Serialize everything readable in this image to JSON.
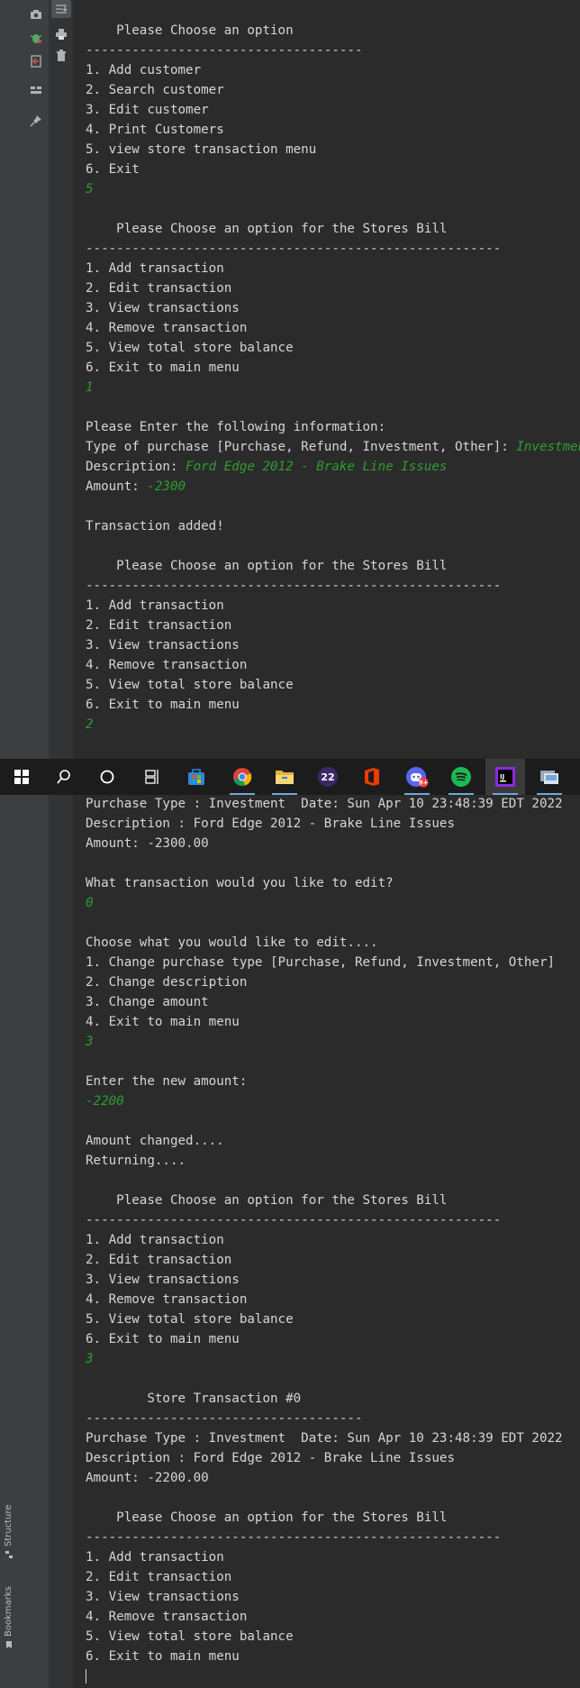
{
  "console_top": [
    {
      "text": "    Please Choose an option"
    },
    {
      "text": "------------------------------------"
    },
    {
      "text": "1. Add customer"
    },
    {
      "text": "2. Search customer"
    },
    {
      "text": "3. Edit customer"
    },
    {
      "text": "4. Print Customers"
    },
    {
      "text": "5. view store transaction menu"
    },
    {
      "text": "6. Exit"
    },
    {
      "input": "5"
    },
    {
      "text": ""
    },
    {
      "text": "    Please Choose an option for the Stores Bill"
    },
    {
      "text": "------------------------------------------------------"
    },
    {
      "text": "1. Add transaction"
    },
    {
      "text": "2. Edit transaction"
    },
    {
      "text": "3. View transactions"
    },
    {
      "text": "4. Remove transaction"
    },
    {
      "text": "5. View total store balance"
    },
    {
      "text": "6. Exit to main menu"
    },
    {
      "input": "1"
    },
    {
      "text": ""
    },
    {
      "text": "Please Enter the following information:"
    },
    {
      "text": "Type of purchase [Purchase, Refund, Investment, Other]: ",
      "input": "Investment"
    },
    {
      "text": "Description: ",
      "input": "Ford Edge 2012 - Brake Line Issues"
    },
    {
      "text": "Amount: ",
      "input": "-2300"
    },
    {
      "text": ""
    },
    {
      "text": "Transaction added!"
    },
    {
      "text": ""
    },
    {
      "text": "    Please Choose an option for the Stores Bill"
    },
    {
      "text": "------------------------------------------------------"
    },
    {
      "text": "1. Add transaction"
    },
    {
      "text": "2. Edit transaction"
    },
    {
      "text": "3. View transactions"
    },
    {
      "text": "4. Remove transaction"
    },
    {
      "text": "5. View total store balance"
    },
    {
      "text": "6. Exit to main menu"
    },
    {
      "input": "2"
    }
  ],
  "console_bottom": [
    {
      "text": "Purchase Type : Investment  Date: Sun Apr 10 23:48:39 EDT 2022"
    },
    {
      "text": "Description : Ford Edge 2012 - Brake Line Issues"
    },
    {
      "text": "Amount: -2300.00"
    },
    {
      "text": ""
    },
    {
      "text": "What transaction would you like to edit?"
    },
    {
      "input": "0"
    },
    {
      "text": ""
    },
    {
      "text": "Choose what you would like to edit...."
    },
    {
      "text": "1. Change purchase type [Purchase, Refund, Investment, Other]"
    },
    {
      "text": "2. Change description"
    },
    {
      "text": "3. Change amount"
    },
    {
      "text": "4. Exit to main menu"
    },
    {
      "input": "3"
    },
    {
      "text": ""
    },
    {
      "text": "Enter the new amount:"
    },
    {
      "input": "-2200"
    },
    {
      "text": ""
    },
    {
      "text": "Amount changed...."
    },
    {
      "text": "Returning...."
    },
    {
      "text": ""
    },
    {
      "text": "    Please Choose an option for the Stores Bill"
    },
    {
      "text": "------------------------------------------------------"
    },
    {
      "text": "1. Add transaction"
    },
    {
      "text": "2. Edit transaction"
    },
    {
      "text": "3. View transactions"
    },
    {
      "text": "4. Remove transaction"
    },
    {
      "text": "5. View total store balance"
    },
    {
      "text": "6. Exit to main menu"
    },
    {
      "input": "3"
    },
    {
      "text": ""
    },
    {
      "text": "        Store Transaction #0"
    },
    {
      "text": "------------------------------------"
    },
    {
      "text": "Purchase Type : Investment  Date: Sun Apr 10 23:48:39 EDT 2022"
    },
    {
      "text": "Description : Ford Edge 2012 - Brake Line Issues"
    },
    {
      "text": "Amount: -2200.00"
    },
    {
      "text": ""
    },
    {
      "text": "    Please Choose an option for the Stores Bill"
    },
    {
      "text": "------------------------------------------------------"
    },
    {
      "text": "1. Add transaction"
    },
    {
      "text": "2. Edit transaction"
    },
    {
      "text": "3. View transactions"
    },
    {
      "text": "4. Remove transaction"
    },
    {
      "text": "5. View total store balance"
    },
    {
      "text": "6. Exit to main menu"
    }
  ],
  "side_labels": {
    "structure": "Structure",
    "bookmarks": "Bookmarks"
  },
  "taskbar_items": [
    {
      "name": "start-icon"
    },
    {
      "name": "search-icon"
    },
    {
      "name": "cortana-icon"
    },
    {
      "name": "task-view-icon"
    },
    {
      "name": "store-icon"
    },
    {
      "name": "chrome-icon"
    },
    {
      "name": "file-explorer-icon"
    },
    {
      "name": "app-22-icon",
      "label": "22"
    },
    {
      "name": "office-icon"
    },
    {
      "name": "discord-icon",
      "badge": "9+"
    },
    {
      "name": "spotify-icon"
    },
    {
      "name": "intellij-icon",
      "label": "IJ"
    },
    {
      "name": "app-icon"
    }
  ],
  "colors": {
    "background": "#2b2b2b",
    "text": "#d6d6d6",
    "input": "#2f9e2f",
    "gutter": "#3c3f41",
    "taskbar": "#1c1c1c"
  }
}
